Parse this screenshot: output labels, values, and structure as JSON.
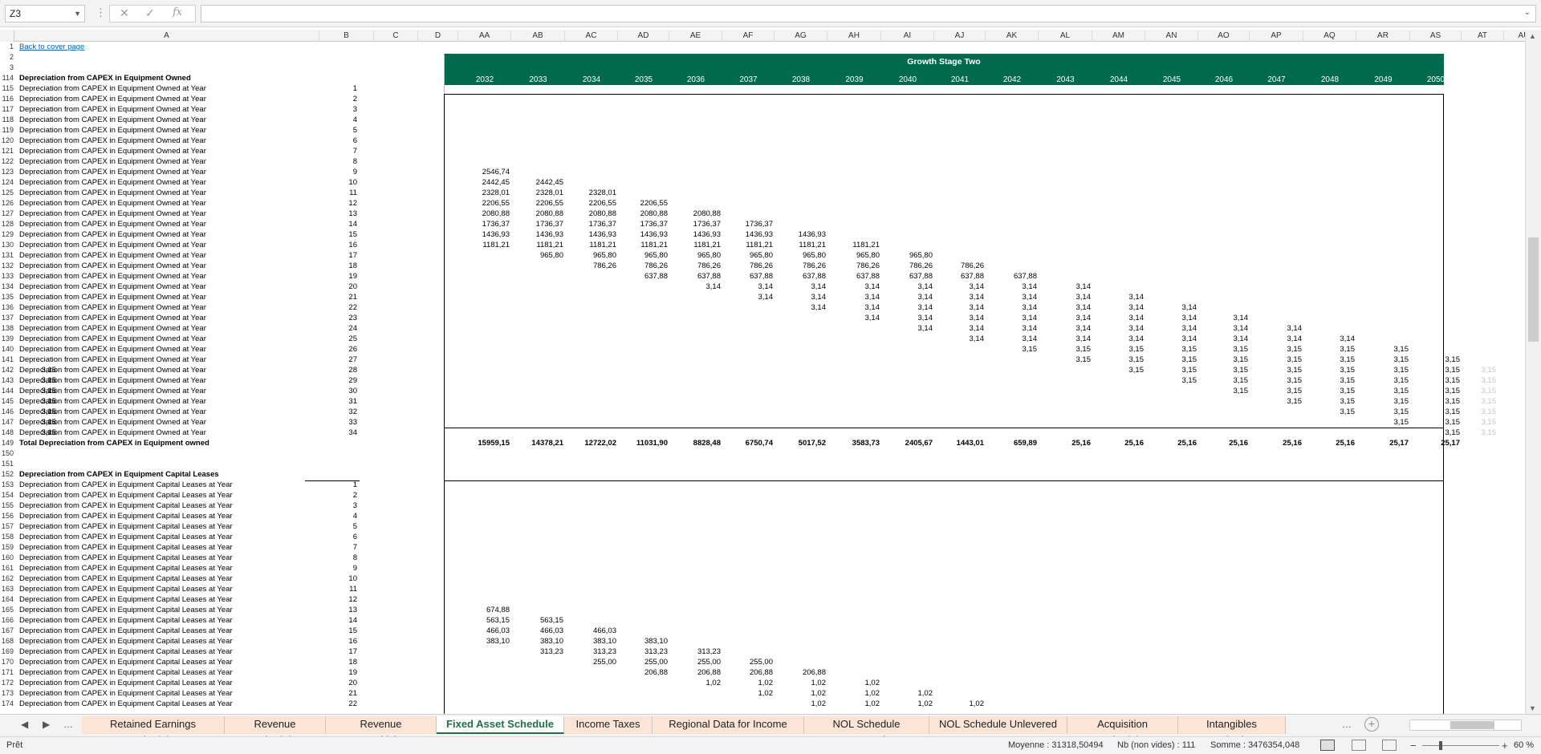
{
  "formula_bar": {
    "name_box": "Z3",
    "fx": "fx",
    "formula": ""
  },
  "columns": [
    {
      "id": "A",
      "w": 380
    },
    {
      "id": "B",
      "w": 68
    },
    {
      "id": "C",
      "w": 55
    },
    {
      "id": "D",
      "w": 50
    },
    {
      "id": "AA",
      "w": 66
    },
    {
      "id": "AB",
      "w": 67
    },
    {
      "id": "AC",
      "w": 66
    },
    {
      "id": "AD",
      "w": 64
    },
    {
      "id": "AE",
      "w": 66
    },
    {
      "id": "AF",
      "w": 65
    },
    {
      "id": "AG",
      "w": 66
    },
    {
      "id": "AH",
      "w": 67
    },
    {
      "id": "AI",
      "w": 66
    },
    {
      "id": "AJ",
      "w": 64
    },
    {
      "id": "AK",
      "w": 66
    },
    {
      "id": "AL",
      "w": 67
    },
    {
      "id": "AM",
      "w": 66
    },
    {
      "id": "AN",
      "w": 66
    },
    {
      "id": "AO",
      "w": 64
    },
    {
      "id": "AP",
      "w": 67
    },
    {
      "id": "AQ",
      "w": 66
    },
    {
      "id": "AR",
      "w": 67
    },
    {
      "id": "AS",
      "w": 64
    },
    {
      "id": "AT",
      "w": 53
    },
    {
      "id": "AU",
      "w": 50
    }
  ],
  "header": {
    "back_link": "Back to cover page",
    "stage_title": "Growth Stage Two",
    "years": [
      "2032",
      "2033",
      "2034",
      "2035",
      "2036",
      "2037",
      "2038",
      "2039",
      "2040",
      "2041",
      "2042",
      "2043",
      "2044",
      "2045",
      "2046",
      "2047",
      "2048",
      "2049",
      "2050"
    ]
  },
  "owned": {
    "title": "Depreciation from CAPEX in Equipment Owned",
    "row_label": "Depreciation from CAPEX in Equipment Owned at Year",
    "first_row": 115,
    "year_index": [
      1,
      2,
      3,
      4,
      5,
      6,
      7,
      8,
      9,
      10,
      11,
      12,
      13,
      14,
      15,
      16,
      17,
      18,
      19,
      20,
      21,
      22,
      23,
      24,
      25,
      26,
      27,
      28,
      29,
      30,
      31,
      32,
      33,
      34
    ],
    "data": {
      "123": {
        "0": "2546,74"
      },
      "124": {
        "0": "2442,45",
        "1": "2442,45"
      },
      "125": {
        "0": "2328,01",
        "1": "2328,01",
        "2": "2328,01"
      },
      "126": {
        "0": "2206,55",
        "1": "2206,55",
        "2": "2206,55",
        "3": "2206,55"
      },
      "127": {
        "0": "2080,88",
        "1": "2080,88",
        "2": "2080,88",
        "3": "2080,88",
        "4": "2080,88"
      },
      "128": {
        "0": "1736,37",
        "1": "1736,37",
        "2": "1736,37",
        "3": "1736,37",
        "4": "1736,37",
        "5": "1736,37"
      },
      "129": {
        "0": "1436,93",
        "1": "1436,93",
        "2": "1436,93",
        "3": "1436,93",
        "4": "1436,93",
        "5": "1436,93",
        "6": "1436,93"
      },
      "130": {
        "0": "1181,21",
        "1": "1181,21",
        "2": "1181,21",
        "3": "1181,21",
        "4": "1181,21",
        "5": "1181,21",
        "6": "1181,21",
        "7": "1181,21"
      },
      "131": {
        "1": "965,80",
        "2": "965,80",
        "3": "965,80",
        "4": "965,80",
        "5": "965,80",
        "6": "965,80",
        "7": "965,80",
        "8": "965,80"
      },
      "132": {
        "2": "786,26",
        "3": "786,26",
        "4": "786,26",
        "5": "786,26",
        "6": "786,26",
        "7": "786,26",
        "8": "786,26",
        "9": "786,26"
      },
      "133": {
        "3": "637,88",
        "4": "637,88",
        "5": "637,88",
        "6": "637,88",
        "7": "637,88",
        "8": "637,88",
        "9": "637,88",
        "10": "637,88"
      },
      "134": {
        "4": "3,14",
        "5": "3,14",
        "6": "3,14",
        "7": "3,14",
        "8": "3,14",
        "9": "3,14",
        "10": "3,14",
        "11": "3,14"
      },
      "135": {
        "5": "3,14",
        "6": "3,14",
        "7": "3,14",
        "8": "3,14",
        "9": "3,14",
        "10": "3,14",
        "11": "3,14",
        "12": "3,14"
      },
      "136": {
        "6": "3,14",
        "7": "3,14",
        "8": "3,14",
        "9": "3,14",
        "10": "3,14",
        "11": "3,14",
        "12": "3,14",
        "13": "3,14"
      },
      "137": {
        "7": "3,14",
        "8": "3,14",
        "9": "3,14",
        "10": "3,14",
        "11": "3,14",
        "12": "3,14",
        "13": "3,14",
        "14": "3,14"
      },
      "138": {
        "8": "3,14",
        "9": "3,14",
        "10": "3,14",
        "11": "3,14",
        "12": "3,14",
        "13": "3,14",
        "14": "3,14",
        "15": "3,14"
      },
      "139": {
        "9": "3,14",
        "10": "3,14",
        "11": "3,14",
        "12": "3,14",
        "13": "3,14",
        "14": "3,14",
        "15": "3,14",
        "16": "3,14"
      },
      "140": {
        "10": "3,15",
        "11": "3,15",
        "12": "3,15",
        "13": "3,15",
        "14": "3,15",
        "15": "3,15",
        "16": "3,15",
        "17": "3,15"
      },
      "141": {
        "11": "3,15",
        "12": "3,15",
        "13": "3,15",
        "14": "3,15",
        "15": "3,15",
        "16": "3,15",
        "17": "3,15",
        "18": "3,15"
      },
      "142": {
        "12": "3,15",
        "13": "3,15",
        "14": "3,15",
        "15": "3,15",
        "16": "3,15",
        "17": "3,15",
        "18": "3,15",
        "19": "3,15"
      },
      "143": {
        "13": "3,15",
        "14": "3,15",
        "15": "3,15",
        "16": "3,15",
        "17": "3,15",
        "18": "3,15",
        "19": "3,15",
        "20": "3,15"
      },
      "144": {
        "14": "3,15",
        "15": "3,15",
        "16": "3,15",
        "17": "3,15",
        "18": "3,15",
        "19": "3,15",
        "20": "3,15"
      },
      "145": {
        "15": "3,15",
        "16": "3,15",
        "17": "3,15",
        "18": "3,15",
        "19": "3,15",
        "20": "3,15"
      },
      "146": {
        "16": "3,15",
        "17": "3,15",
        "18": "3,15",
        "19": "3,15",
        "20": "3,15"
      },
      "147": {
        "17": "3,15",
        "18": "3,15",
        "19": "3,15",
        "20": "3,15"
      },
      "148": {
        "18": "3,15",
        "19": "3,15",
        "20": "3,15"
      }
    },
    "total_label": "Total Depreciation from CAPEX in Equipment owned",
    "totals": [
      "15959,15",
      "14378,21",
      "12722,02",
      "11031,90",
      "8828,48",
      "6750,74",
      "5017,52",
      "3583,73",
      "2405,67",
      "1443,01",
      "659,89",
      "25,16",
      "25,16",
      "25,16",
      "25,16",
      "25,16",
      "25,16",
      "25,17",
      "25,17"
    ]
  },
  "leases": {
    "title": "Depreciation from CAPEX in Equipment Capital Leases",
    "row_label": "Depreciation from CAPEX in Equipment Capital Leases at Year",
    "first_row": 153,
    "year_index": [
      1,
      2,
      3,
      4,
      5,
      6,
      7,
      8,
      9,
      10,
      11,
      12,
      13,
      14,
      15,
      16,
      17,
      18,
      19,
      20,
      21,
      22
    ],
    "data": {
      "165": {
        "0": "674,88"
      },
      "166": {
        "0": "563,15",
        "1": "563,15"
      },
      "167": {
        "0": "466,03",
        "1": "466,03",
        "2": "466,03"
      },
      "168": {
        "0": "383,10",
        "1": "383,10",
        "2": "383,10",
        "3": "383,10"
      },
      "169": {
        "1": "313,23",
        "2": "313,23",
        "3": "313,23",
        "4": "313,23"
      },
      "170": {
        "2": "255,00",
        "3": "255,00",
        "4": "255,00",
        "5": "255,00"
      },
      "171": {
        "3": "206,88",
        "4": "206,88",
        "5": "206,88",
        "6": "206,88"
      },
      "172": {
        "4": "1,02",
        "5": "1,02",
        "6": "1,02",
        "7": "1,02"
      },
      "173": {
        "5": "1,02",
        "6": "1,02",
        "7": "1,02",
        "8": "1,02"
      },
      "174": {
        "6": "1,02",
        "7": "1,02",
        "8": "1,02",
        "9": "1,02"
      }
    }
  },
  "sheet_tabs": [
    {
      "label": "Retained Earnings Schedule",
      "colored": true
    },
    {
      "label": "Revenue Schedule",
      "colored": true
    },
    {
      "label": "Revenue Sensitivity",
      "colored": true
    },
    {
      "label": "Fixed Asset Schedule",
      "active": true
    },
    {
      "label": "Income Taxes",
      "colored": true
    },
    {
      "label": "Regional Data for Income Taxes",
      "colored": true
    },
    {
      "label": "NOL Schedule Levered",
      "colored": true
    },
    {
      "label": "NOL Schedule Unlevered",
      "colored": true
    },
    {
      "label": "Acquisition Schedule",
      "colored": true
    },
    {
      "label": "Intangibles Schedu",
      "colored": true
    }
  ],
  "status": {
    "ready": "Prêt",
    "average": "Moyenne : 31318,50494",
    "count": "Nb (non vides) : 111",
    "sum": "Somme : 3476354,048",
    "zoom": "60 %"
  },
  "colors": {
    "banner": "#006a4e",
    "active_tab": "#1e7145",
    "tab_fill": "#fce4d6",
    "link": "#0563c1"
  }
}
